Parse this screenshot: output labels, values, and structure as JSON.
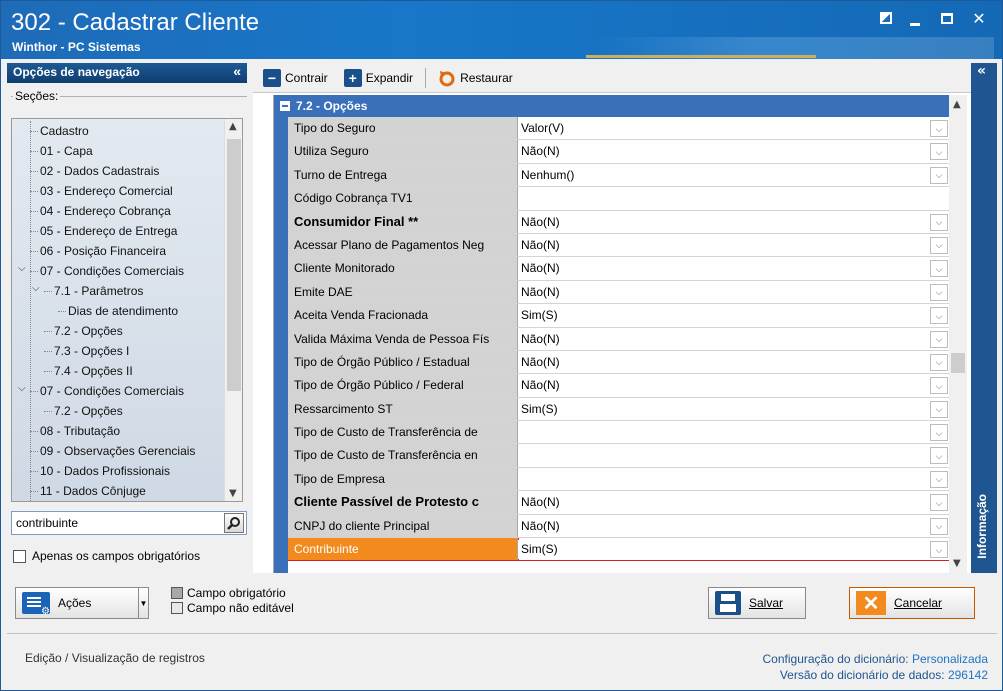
{
  "window": {
    "title": "302 - Cadastrar Cliente",
    "subtitle": "Winthor - PC Sistemas"
  },
  "nav": {
    "header": "Opções de navegação",
    "sections_label": "Seções:",
    "tree": [
      {
        "label": "Cadastro",
        "level": 0,
        "expand": ""
      },
      {
        "label": "01 - Capa",
        "level": 0,
        "expand": ""
      },
      {
        "label": "02 - Dados Cadastrais",
        "level": 0,
        "expand": ""
      },
      {
        "label": "03 - Endereço Comercial",
        "level": 0,
        "expand": ""
      },
      {
        "label": "04 - Endereço Cobrança",
        "level": 0,
        "expand": ""
      },
      {
        "label": "05 - Endereço de Entrega",
        "level": 0,
        "expand": ""
      },
      {
        "label": "06 - Posição Financeira",
        "level": 0,
        "expand": ""
      },
      {
        "label": "07 - Condições Comerciais",
        "level": 0,
        "expand": "open"
      },
      {
        "label": "7.1 - Parâmetros",
        "level": 1,
        "expand": "open"
      },
      {
        "label": "Dias de atendimento",
        "level": 2,
        "expand": ""
      },
      {
        "label": "7.2 - Opções",
        "level": 1,
        "expand": ""
      },
      {
        "label": "7.3 - Opções I",
        "level": 1,
        "expand": ""
      },
      {
        "label": "7.4 - Opções II",
        "level": 1,
        "expand": ""
      },
      {
        "label": "07 - Condições Comerciais",
        "level": 0,
        "expand": "open"
      },
      {
        "label": "7.2 - Opções",
        "level": 1,
        "expand": ""
      },
      {
        "label": "08 - Tributação",
        "level": 0,
        "expand": ""
      },
      {
        "label": "09 - Observações Gerenciais",
        "level": 0,
        "expand": ""
      },
      {
        "label": "10 - Dados Profissionais",
        "level": 0,
        "expand": ""
      },
      {
        "label": "11 - Dados Cônjuge",
        "level": 0,
        "expand": ""
      }
    ],
    "search_value": "contribuinte",
    "only_required_label": "Apenas os campos obrigatórios"
  },
  "toolbar": {
    "contrair": "Contrair",
    "expandir": "Expandir",
    "restaurar": "Restaurar"
  },
  "grid": {
    "group_title": "7.2 - Opções",
    "rows": [
      {
        "label": "Tipo do Seguro",
        "value": "Valor(V)",
        "bold": false,
        "dropdown": true
      },
      {
        "label": "Utiliza Seguro",
        "value": "Não(N)",
        "bold": false,
        "dropdown": true
      },
      {
        "label": "Turno de Entrega",
        "value": "Nenhum()",
        "bold": false,
        "dropdown": true
      },
      {
        "label": "Código Cobrança TV1",
        "value": "",
        "bold": false,
        "dropdown": false
      },
      {
        "label": "Consumidor Final **",
        "value": "Não(N)",
        "bold": true,
        "dropdown": true
      },
      {
        "label": "Acessar Plano de Pagamentos Neg",
        "value": "Não(N)",
        "bold": false,
        "dropdown": true
      },
      {
        "label": "Cliente Monitorado",
        "value": "Não(N)",
        "bold": false,
        "dropdown": true
      },
      {
        "label": "Emite DAE",
        "value": "Não(N)",
        "bold": false,
        "dropdown": true
      },
      {
        "label": "Aceita Venda Fracionada",
        "value": "Sim(S)",
        "bold": false,
        "dropdown": true
      },
      {
        "label": "Valida Máxima Venda de Pessoa Fís",
        "value": "Não(N)",
        "bold": false,
        "dropdown": true
      },
      {
        "label": "Tipo de Órgão Público / Estadual",
        "value": "Não(N)",
        "bold": false,
        "dropdown": true
      },
      {
        "label": "Tipo de Órgão Público / Federal",
        "value": "Não(N)",
        "bold": false,
        "dropdown": true
      },
      {
        "label": "Ressarcimento ST",
        "value": "Sim(S)",
        "bold": false,
        "dropdown": true
      },
      {
        "label": "Tipo de Custo de Transferência de",
        "value": "",
        "bold": false,
        "dropdown": true
      },
      {
        "label": "Tipo de Custo de Transferência en",
        "value": "",
        "bold": false,
        "dropdown": true
      },
      {
        "label": "Tipo de Empresa",
        "value": "",
        "bold": false,
        "dropdown": true
      },
      {
        "label": "Cliente Passível de Protesto c",
        "value": "Não(N)",
        "bold": true,
        "dropdown": true
      },
      {
        "label": "CNPJ do cliente Principal",
        "value": "Não(N)",
        "bold": false,
        "dropdown": true
      },
      {
        "label": "Contribuinte",
        "value": "Sim(S)",
        "bold": false,
        "dropdown": true,
        "selected": true
      }
    ]
  },
  "info_panel": {
    "label": "Informação"
  },
  "actions": {
    "acoes": "Ações",
    "salvar": "Salvar",
    "cancelar": "Cancelar"
  },
  "legend": {
    "required": "Campo obrigatório",
    "not_editable": "Campo não editável",
    "required_color": "#a8a8a8",
    "not_editable_color": "#e8e8e8"
  },
  "status": {
    "left": "Edição / Visualização de registros",
    "config_label": "Configuração do dicionário:",
    "config_value": "Personalizada",
    "version_label": "Versão do dicionário de dados:",
    "version_value": "296142"
  },
  "colors": {
    "accent": "#1f5590",
    "group": "#3a6fb9",
    "selected": "#f28a1e",
    "highlight_border": "#d91e1e"
  }
}
